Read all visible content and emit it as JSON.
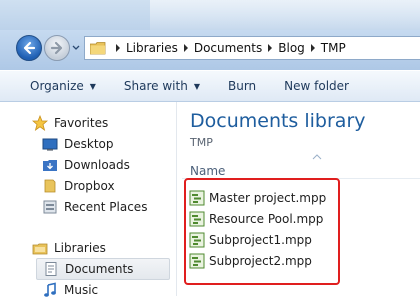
{
  "address": {
    "crumbs": [
      "Libraries",
      "Documents",
      "Blog",
      "TMP"
    ]
  },
  "toolbar": {
    "organize": "Organize",
    "share_with": "Share with",
    "burn": "Burn",
    "new_folder": "New folder"
  },
  "nav": {
    "favorites": "Favorites",
    "desktop": "Desktop",
    "downloads": "Downloads",
    "dropbox": "Dropbox",
    "recent_places": "Recent Places",
    "libraries": "Libraries",
    "documents": "Documents",
    "music": "Music"
  },
  "library": {
    "title": "Documents library",
    "subtitle": "TMP",
    "column_name": "Name"
  },
  "files": [
    {
      "name": "Master project.mpp"
    },
    {
      "name": "Resource Pool.mpp"
    },
    {
      "name": "Subproject1.mpp"
    },
    {
      "name": "Subproject2.mpp"
    }
  ],
  "colors": {
    "title_blue": "#1e5d9e",
    "highlight_red": "#e01e1e"
  }
}
